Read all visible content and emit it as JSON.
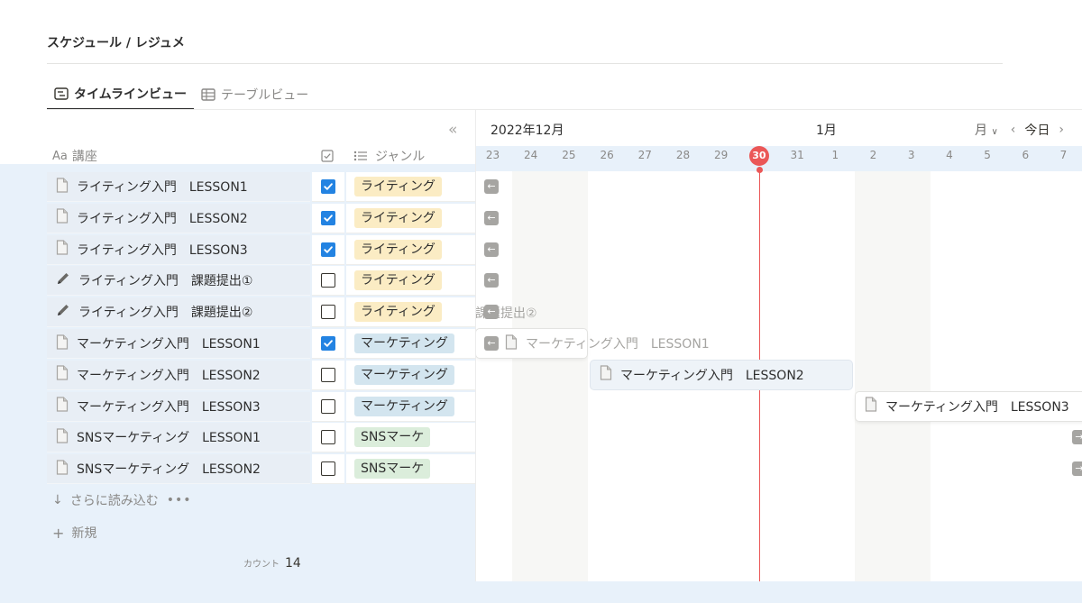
{
  "page": {
    "title": "スケジュール / レジュメ"
  },
  "tabs": [
    {
      "label": "タイムラインビュー",
      "icon": "timeline-icon",
      "active": true
    },
    {
      "label": "テーブルビュー",
      "icon": "table-icon",
      "active": false
    }
  ],
  "table": {
    "columns": {
      "name_prefix": "Aa",
      "name": "講座",
      "done_icon": "checkbox-icon",
      "genre_icon": "list-icon",
      "genre": "ジャンル"
    },
    "rows": [
      {
        "name": "ライティング入門　LESSON1",
        "icon": "page-icon",
        "done": true,
        "genre": "ライティング",
        "genre_color": "#fbecc4"
      },
      {
        "name": "ライティング入門　LESSON2",
        "icon": "page-icon",
        "done": true,
        "genre": "ライティング",
        "genre_color": "#fbecc4"
      },
      {
        "name": "ライティング入門　LESSON3",
        "icon": "page-icon",
        "done": true,
        "genre": "ライティング",
        "genre_color": "#fbecc4"
      },
      {
        "name": "ライティング入門　課題提出①",
        "icon": "pen-icon",
        "done": false,
        "genre": "ライティング",
        "genre_color": "#fbecc4"
      },
      {
        "name": "ライティング入門　課題提出②",
        "icon": "pen-icon",
        "done": false,
        "genre": "ライティング",
        "genre_color": "#fbecc4"
      },
      {
        "name": "マーケティング入門　LESSON1",
        "icon": "page-icon",
        "done": true,
        "genre": "マーケティング",
        "genre_color": "#d3e5ef"
      },
      {
        "name": "マーケティング入門　LESSON2",
        "icon": "page-icon",
        "done": false,
        "genre": "マーケティング",
        "genre_color": "#d3e5ef"
      },
      {
        "name": "マーケティング入門　LESSON3",
        "icon": "page-icon",
        "done": false,
        "genre": "マーケティング",
        "genre_color": "#d3e5ef"
      },
      {
        "name": "SNSマーケティング　LESSON1",
        "icon": "page-icon",
        "done": false,
        "genre": "SNSマーケ",
        "genre_color": "#dbeddb"
      },
      {
        "name": "SNSマーケティング　LESSON2",
        "icon": "page-icon",
        "done": false,
        "genre": "SNSマーケ",
        "genre_color": "#dbeddb"
      }
    ],
    "load_more": "さらに読み込む",
    "new_label": "新規",
    "count_label": "カウント",
    "count_value": "14"
  },
  "timeline": {
    "month_left": "2022年12月",
    "month_right": "1月",
    "scale_label": "月",
    "today_label": "今日",
    "days": [
      "23",
      "24",
      "25",
      "26",
      "27",
      "28",
      "29",
      "30",
      "31",
      "1",
      "2",
      "3",
      "4",
      "5",
      "6",
      "7"
    ],
    "today_day": "30",
    "ghost_text": "課題提出②",
    "bars": [
      {
        "label": "マーケティング入門　LESSON1",
        "style": "ghosted"
      },
      {
        "label": "マーケティング入門　LESSON2",
        "style": "selected"
      },
      {
        "label": "マーケティング入門　LESSON3",
        "style": "plain"
      }
    ]
  }
}
